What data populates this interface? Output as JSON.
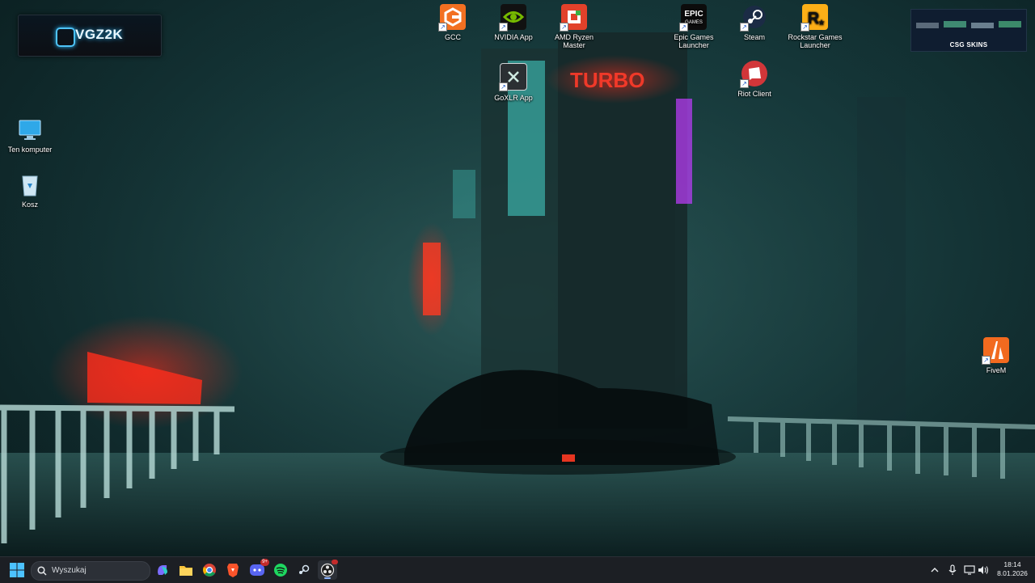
{
  "desktop": {
    "icons": [
      {
        "label": "Ten komputer",
        "icon": "monitor-icon"
      },
      {
        "label": "Kosz",
        "icon": "recycle-bin-icon"
      },
      {
        "label": "GCC",
        "icon": "gcc-icon"
      },
      {
        "label": "NVIDIA App",
        "icon": "nvidia-icon"
      },
      {
        "label": "AMD Ryzen Master",
        "icon": "amd-ryzen-master-icon"
      },
      {
        "label": "GoXLR App",
        "icon": "goxlr-icon"
      },
      {
        "label": "Epic Games Launcher",
        "icon": "epic-games-icon"
      },
      {
        "label": "Steam",
        "icon": "steam-icon"
      },
      {
        "label": "Rockstar Games Launcher",
        "icon": "rockstar-icon"
      },
      {
        "label": "Riot Client",
        "icon": "riot-icon"
      },
      {
        "label": "FiveM",
        "icon": "fivem-icon"
      }
    ],
    "widgets": {
      "vgz_logo": "VGZ2K",
      "csg_label": "CSG SKINS"
    },
    "wallpaper_signs": {
      "turbo": "TURBO"
    }
  },
  "taskbar": {
    "search_placeholder": "Wyszukaj",
    "pinned": [
      {
        "name": "copilot-icon"
      },
      {
        "name": "file-explorer-icon"
      },
      {
        "name": "chrome-icon"
      },
      {
        "name": "brave-icon"
      },
      {
        "name": "discord-icon",
        "badge": "9+"
      },
      {
        "name": "spotify-icon"
      },
      {
        "name": "steam-icon"
      },
      {
        "name": "obs-icon",
        "active": true
      }
    ],
    "clock": {
      "time": "18:14",
      "date": "8.01.2026"
    },
    "colors": {
      "bg": "#1c1f24",
      "accent": "#8fb6ff"
    }
  }
}
